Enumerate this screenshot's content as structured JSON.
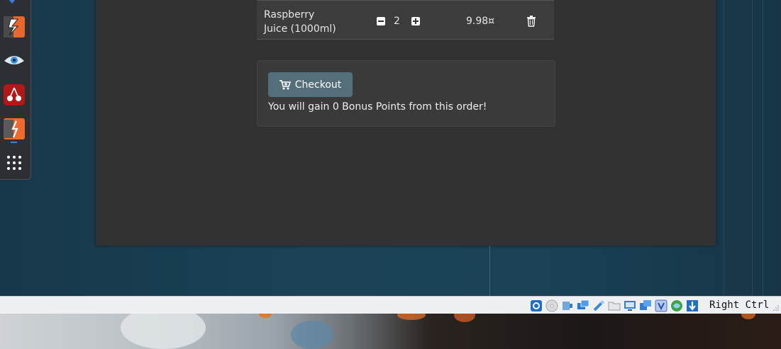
{
  "cart": {
    "item_name_line1": "Raspberry",
    "item_name_line2": "Juice (1000ml)",
    "quantity": "2",
    "price": "9.98¤"
  },
  "checkout": {
    "button_label": "Checkout",
    "bonus_text": "You will gain 0 Bonus Points from this order!"
  },
  "statusbar": {
    "host_key": "Right Ctrl"
  },
  "dock": {
    "items": [
      "burp-suite-icon",
      "eye-icon",
      "cherry-icon",
      "burp-alt-icon",
      "app-grid-icon"
    ]
  },
  "colors": {
    "app_bg": "#313131",
    "button_bg": "#546e7a",
    "desktop_bg": "#1b4256"
  }
}
